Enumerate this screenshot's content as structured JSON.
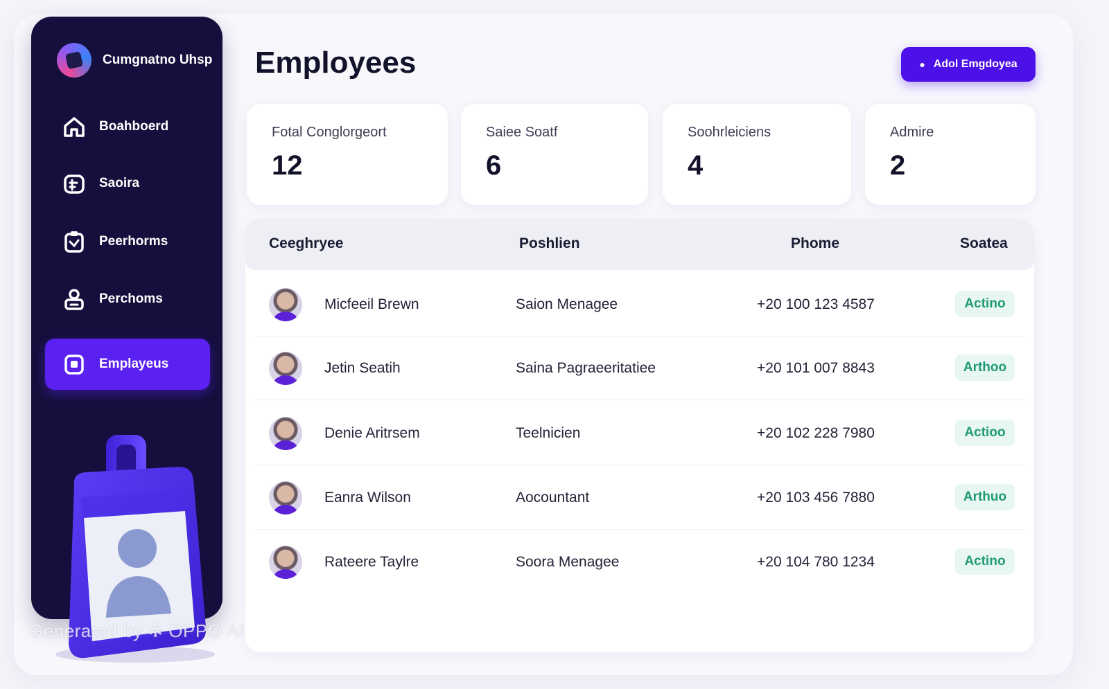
{
  "brand": {
    "name": "Cumgnatno Uhsp"
  },
  "sidebar": {
    "items": [
      {
        "label": "Boahboerd",
        "icon": "home-icon",
        "active": false
      },
      {
        "label": "Saoira",
        "icon": "sales-icon",
        "active": false
      },
      {
        "label": "Peerhorms",
        "icon": "clipboard-icon",
        "active": false
      },
      {
        "label": "Perchoms",
        "icon": "user-lock-icon",
        "active": false
      },
      {
        "label": "Emplayeus",
        "icon": "id-card-icon",
        "active": true
      }
    ]
  },
  "header": {
    "title": "Employees",
    "add_button_label": "Adol Emgdoyea"
  },
  "stats": [
    {
      "label": "Fotal Conglorgeort",
      "value": "12"
    },
    {
      "label": "Saiee Soatf",
      "value": "6"
    },
    {
      "label": "Soohrleiciens",
      "value": "4"
    },
    {
      "label": "Admire",
      "value": "2"
    }
  ],
  "table": {
    "columns": [
      "Ceeghryee",
      "Poshlien",
      "Phome",
      "Soatea"
    ],
    "rows": [
      {
        "name": "Micfeeil Brewn",
        "position": "Saion Menagee",
        "phone": "+20 100 123 4587",
        "status": "Actino"
      },
      {
        "name": "Jetin Seatih",
        "position": "Saina Pagraeeritatiee",
        "phone": "+20 101 007 8843",
        "status": "Arthoo"
      },
      {
        "name": "Denie Aritrsem",
        "position": "Teelnicien",
        "phone": "+20 102 228 7980",
        "status": "Actioo"
      },
      {
        "name": "Eanra Wilson",
        "position": "Aocountant",
        "phone": "+20 103 456 7880",
        "status": "Arthuo"
      },
      {
        "name": "Rateere Taylre",
        "position": "Soora Menagee",
        "phone": "+20 104 780 1234",
        "status": "Actino"
      }
    ]
  },
  "watermark": "Generated by ✲ OPPO AI",
  "colors": {
    "sidebar_bg": "#140f3c",
    "accent": "#4c10e8",
    "active_nav": "#5b21f0",
    "status_bg": "#e8f7f1",
    "status_text": "#1f9a78"
  }
}
